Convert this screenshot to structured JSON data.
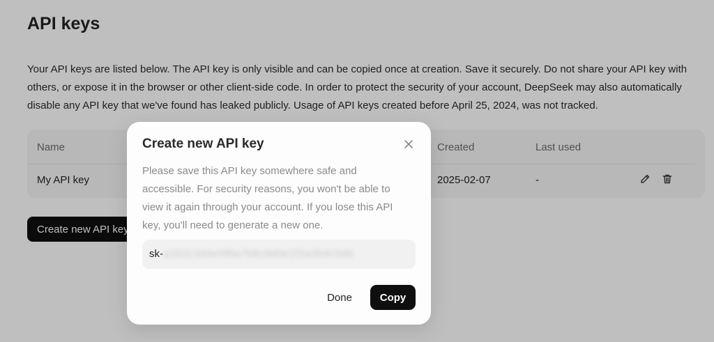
{
  "page": {
    "title": "API keys",
    "description": "Your API keys are listed below. The API key is only visible and can be copied once at creation. Save it securely. Do not share your API key with others, or expose it in the browser or other client-side code. In order to protect the security of your account, DeepSeek may also automatically disable any API key that we've found has leaked publicly. Usage of API keys created before April 25, 2024, was not tracked."
  },
  "table": {
    "columns": {
      "name": "Name",
      "created": "Created",
      "last_used": "Last used"
    },
    "rows": [
      {
        "name": "My API key",
        "created": "2025-02-07",
        "last_used": "-"
      }
    ],
    "row_action_icons": [
      "pencil-icon",
      "trash-icon"
    ]
  },
  "create_button_label": "Create new API key",
  "modal": {
    "title": "Create new API key",
    "close_icon": "close-icon",
    "message": "Please save this API key somewhere safe and accessible. For security reasons, you won't be able to view it again through your account. If you lose this API key, you'll need to generate a new one.",
    "key_prefix": "sk-",
    "key_masked": "a1b2c3d4e5f6a7b8c9d0e1f2a3b4c5d6",
    "done_label": "Done",
    "copy_label": "Copy"
  },
  "colors": {
    "primary_button": "#0f0f0f",
    "overlay": "rgba(0,0,0,0.25)",
    "modal_bg": "#fdfdfd"
  }
}
